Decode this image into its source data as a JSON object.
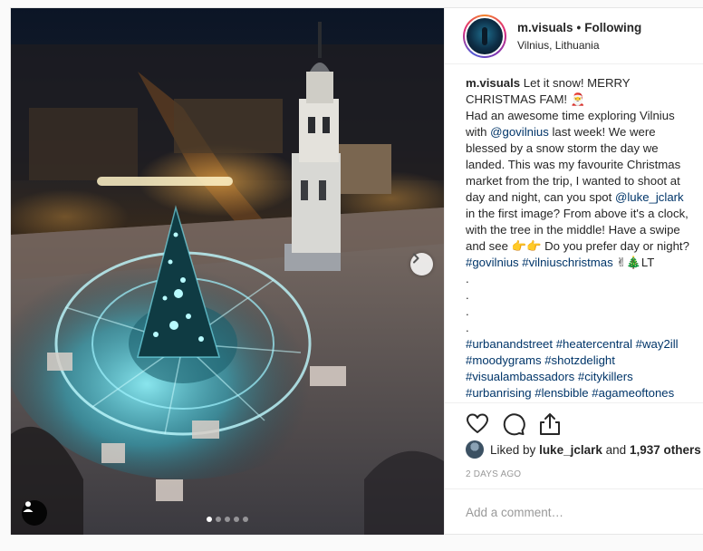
{
  "post": {
    "username": "m.visuals",
    "separator": "•",
    "follow_status": "Following",
    "location": "Vilnius, Lithuania",
    "carousel": {
      "count": 5,
      "active_index": 0
    }
  },
  "caption": {
    "username": "m.visuals",
    "line1": "Let it snow! MERRY CHRISTMAS FAM! 🎅",
    "text_a": "Had an awesome time exploring Vilnius with ",
    "mention_a": "@govilnius",
    "text_b": " last week! We were blessed by a snow storm the day we landed. This was my favourite Christmas market from the trip, I wanted to shoot at day and night, can you spot ",
    "mention_b": "@luke_jclark",
    "text_c": " in the first image? From above it's a clock, with the tree in the middle! Have a swipe and see 👉👉 Do you prefer day or night? ",
    "tags_a": "#govilnius #vilniuschristmas",
    "emoji_end": " ✌🎄LT",
    "dots": [
      ".",
      ".",
      ".",
      "."
    ],
    "tags_b": "#urbanandstreet #heatercentral #way2ill #moodygrams #shotzdelight #visualambassadors #citykillers #urbanrising #lensbible #agameoftones"
  },
  "engagement": {
    "liked_by_prefix": "Liked by",
    "liked_by_user": "luke_jclark",
    "and_text": "and",
    "others_count": "1,937 others",
    "timestamp": "2 DAYS AGO"
  },
  "comment": {
    "placeholder": "Add a comment…"
  },
  "colors": {
    "link": "#003569",
    "muted": "#999999",
    "border": "#efefef",
    "tree_glow": "#4fe3f0"
  }
}
